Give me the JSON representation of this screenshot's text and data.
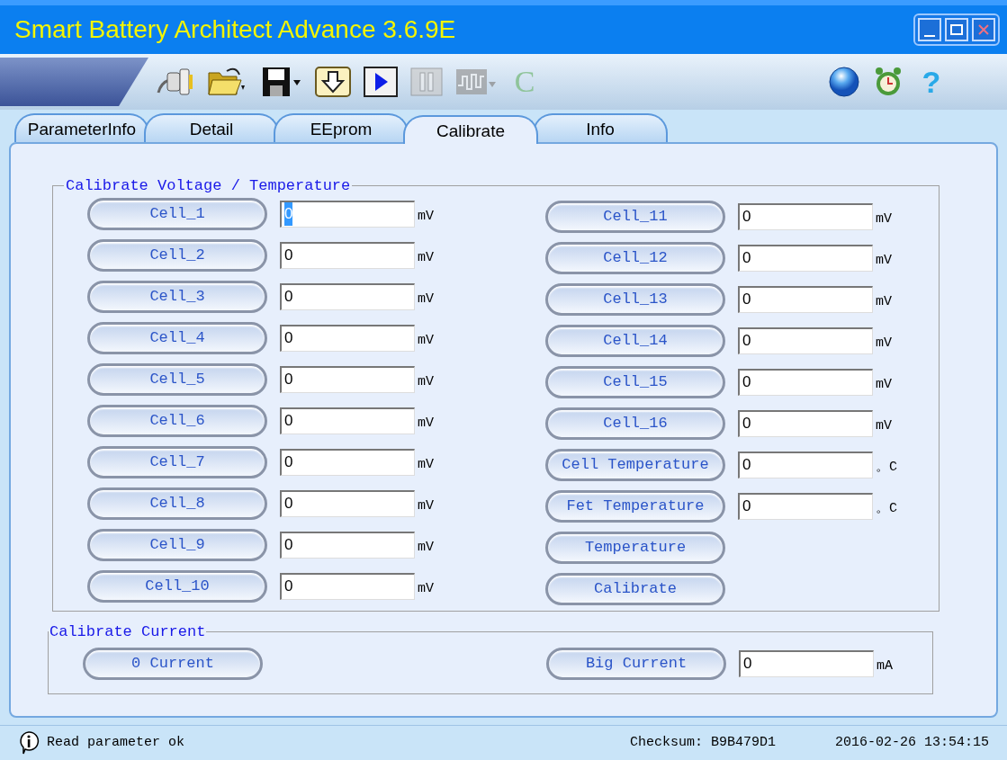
{
  "window": {
    "title": "Smart Battery Architect Advance 3.6.9E"
  },
  "toolbar": [
    {
      "kind": "plug",
      "disabled": false
    },
    {
      "kind": "folder",
      "disabled": false
    },
    {
      "kind": "save",
      "disabled": false
    },
    {
      "kind": "download",
      "disabled": false
    },
    {
      "kind": "play",
      "disabled": false
    },
    {
      "kind": "pause",
      "disabled": true
    },
    {
      "kind": "wave",
      "disabled": true
    },
    {
      "kind": "text",
      "label": "C",
      "disabled": true
    },
    {
      "kind": "sphere",
      "disabled": false
    },
    {
      "kind": "clock",
      "disabled": false
    },
    {
      "kind": "text",
      "label": "?",
      "disabled": false
    }
  ],
  "tabs": [
    {
      "label": "ParameterInfo",
      "selected": false
    },
    {
      "label": "Detail",
      "selected": false
    },
    {
      "label": "EEprom",
      "selected": false
    },
    {
      "label": "Calibrate",
      "selected": true
    },
    {
      "label": "Info",
      "selected": false
    }
  ],
  "voltage_group": {
    "title": "Calibrate Voltage / Temperature",
    "left": [
      {
        "kind": "field",
        "button": "Cell_1",
        "value": "0",
        "unit": "mV",
        "focused": true
      },
      {
        "kind": "field",
        "button": "Cell_2",
        "value": "0",
        "unit": "mV",
        "focused": false
      },
      {
        "kind": "field",
        "button": "Cell_3",
        "value": "0",
        "unit": "mV",
        "focused": false
      },
      {
        "kind": "field",
        "button": "Cell_4",
        "value": "0",
        "unit": "mV",
        "focused": false
      },
      {
        "kind": "field",
        "button": "Cell_5",
        "value": "0",
        "unit": "mV",
        "focused": false
      },
      {
        "kind": "field",
        "button": "Cell_6",
        "value": "0",
        "unit": "mV",
        "focused": false
      },
      {
        "kind": "field",
        "button": "Cell_7",
        "value": "0",
        "unit": "mV",
        "focused": false
      },
      {
        "kind": "field",
        "button": "Cell_8",
        "value": "0",
        "unit": "mV",
        "focused": false
      },
      {
        "kind": "field",
        "button": "Cell_9",
        "value": "0",
        "unit": "mV",
        "focused": false
      },
      {
        "kind": "field",
        "button": "Cell_10",
        "value": "0",
        "unit": "mV",
        "focused": false
      }
    ],
    "right": [
      {
        "kind": "field",
        "button": "Cell_11",
        "value": "0",
        "unit": "mV",
        "focused": false
      },
      {
        "kind": "field",
        "button": "Cell_12",
        "value": "0",
        "unit": "mV",
        "focused": false
      },
      {
        "kind": "field",
        "button": "Cell_13",
        "value": "0",
        "unit": "mV",
        "focused": false
      },
      {
        "kind": "field",
        "button": "Cell_14",
        "value": "0",
        "unit": "mV",
        "focused": false
      },
      {
        "kind": "field",
        "button": "Cell_15",
        "value": "0",
        "unit": "mV",
        "focused": false
      },
      {
        "kind": "field",
        "button": "Cell_16",
        "value": "0",
        "unit": "mV",
        "focused": false
      },
      {
        "kind": "field",
        "button": "Cell Temperature",
        "value": "0",
        "unit": "。C",
        "focused": false
      },
      {
        "kind": "field",
        "button": "Fet Temperature",
        "value": "0",
        "unit": "。C",
        "focused": false
      },
      {
        "kind": "button",
        "button": "Temperature"
      },
      {
        "kind": "button",
        "button": "Calibrate"
      }
    ]
  },
  "current_group": {
    "title": "Calibrate Current",
    "zero_button": "0 Current",
    "big_button": "Big Current",
    "value": "0",
    "unit": "mA"
  },
  "status_bar": {
    "message": "Read parameter ok",
    "checksum": "Checksum: B9B479D1",
    "datetime": "2016-02-26 13:54:15"
  }
}
